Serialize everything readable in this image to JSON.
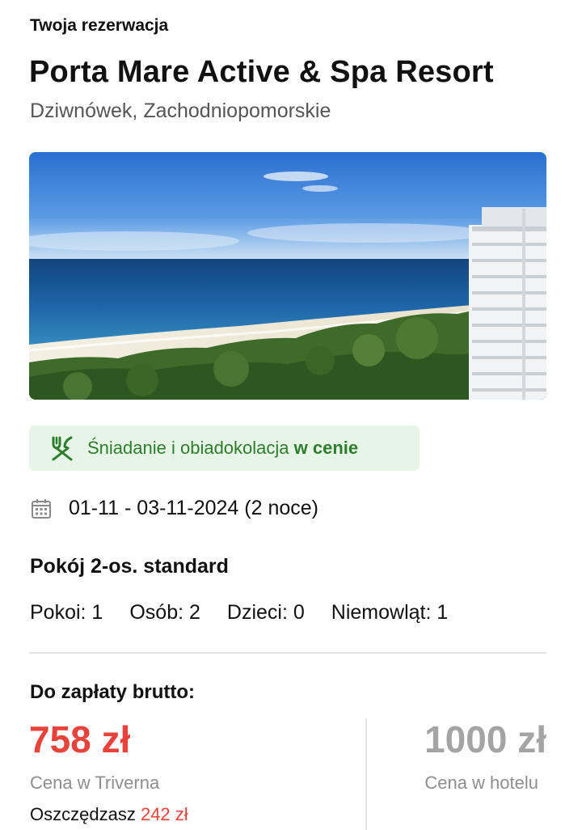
{
  "header": {
    "section_label": "Twoja rezerwacja",
    "hotel_name": "Porta Mare Active & Spa Resort",
    "location": "Dziwnówek, Zachodniopomorskie"
  },
  "photo": {
    "subject": "sea-beach-hotel-photo"
  },
  "board": {
    "icon": "cutlery-icon",
    "text": "Śniadanie i obiadokolacja",
    "highlight": "w cenie",
    "color": "#2e7d2e",
    "background": "#e6f5e6"
  },
  "stay": {
    "icon": "calendar-icon",
    "dates": "01-11 - 03-11-2024 (2 noce)"
  },
  "room": {
    "type": "Pokój 2-os. standard",
    "guests": [
      {
        "label": "Pokoi: 1"
      },
      {
        "label": "Osób: 2"
      },
      {
        "label": "Dzieci: 0"
      },
      {
        "label": "Niemowląt: 1"
      }
    ]
  },
  "pricing": {
    "label": "Do zapłaty brutto:",
    "triverna_price": "758 zł",
    "triverna_label": "Cena w Triverna",
    "savings_label": "Oszczędzasz",
    "savings_amount": "242 zł",
    "hotel_price": "1000 zł",
    "hotel_label": "Cena w hotelu",
    "accent_color": "#e8433a"
  }
}
